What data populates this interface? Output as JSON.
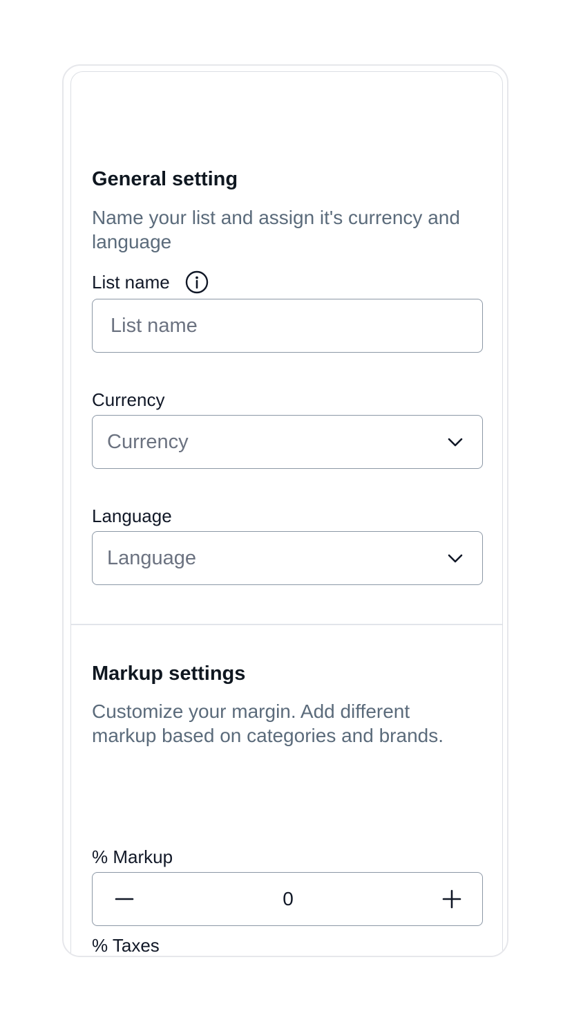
{
  "general": {
    "title": "General setting",
    "description": "Name your list and assign it's currency and language",
    "list_name": {
      "label": "List name",
      "placeholder": "List name",
      "value": ""
    },
    "currency": {
      "label": "Currency",
      "placeholder": "Currency"
    },
    "language": {
      "label": "Language",
      "placeholder": "Language"
    }
  },
  "markup": {
    "title": "Markup settings",
    "description": "Customize your margin. Add different markup based on categories and brands.",
    "percent_markup": {
      "label": "% Markup",
      "value": "0"
    },
    "percent_taxes": {
      "label": "% Taxes"
    }
  },
  "icons": {
    "info": "info-circle-icon",
    "chevron": "chevron-down-icon",
    "minus": "minus-icon",
    "plus": "plus-icon"
  },
  "colors": {
    "title": "#0f1720",
    "description": "#5b6b7b",
    "border": "#8b97a5",
    "placeholder": "#6b7280"
  }
}
